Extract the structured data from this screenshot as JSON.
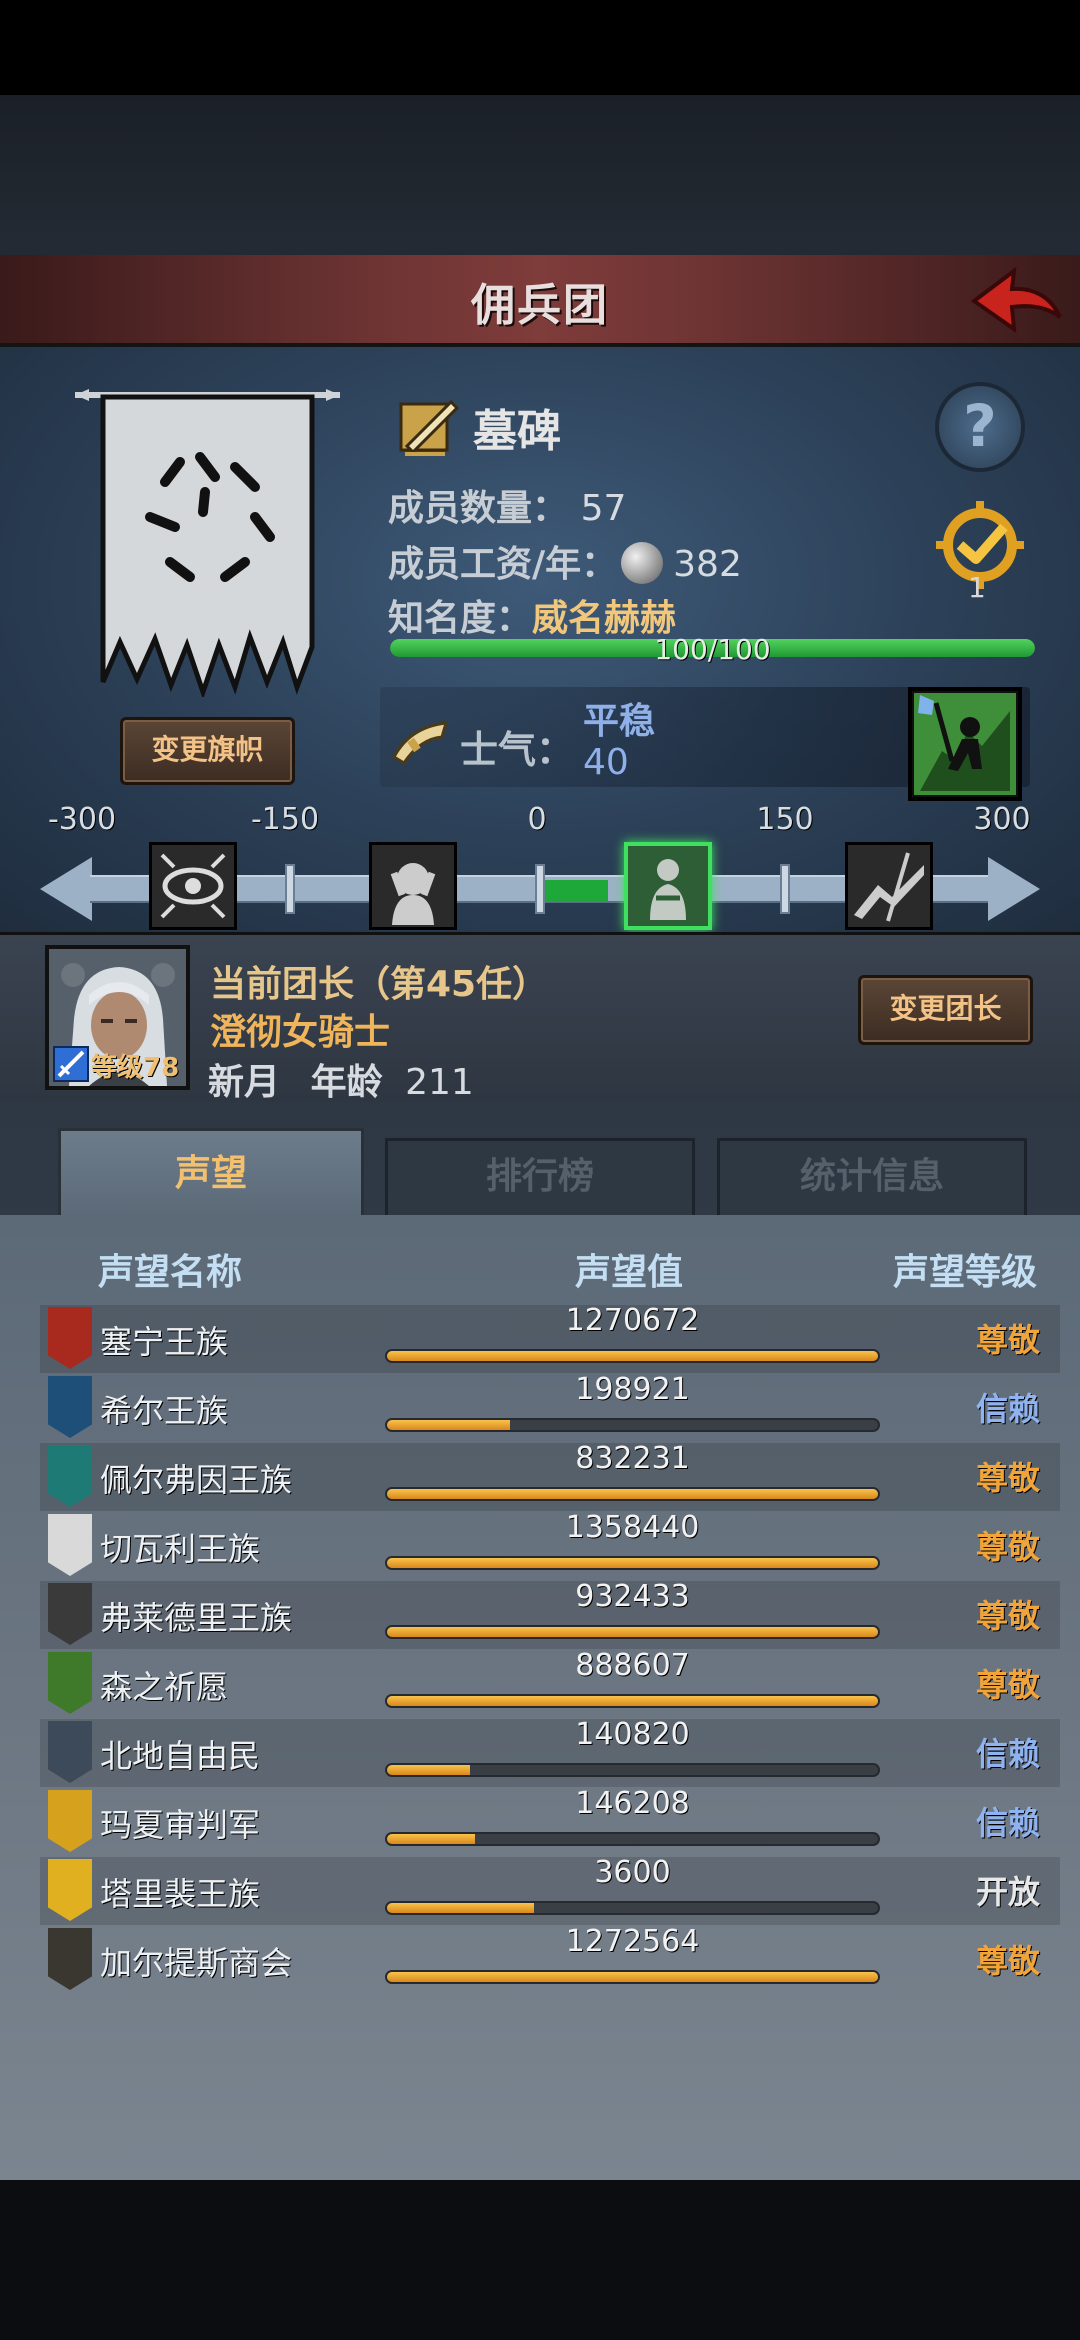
{
  "header": {
    "title": "佣兵团"
  },
  "guild": {
    "change_banner_label": "变更旗帜",
    "name": "墓碑",
    "members_label": "成员数量：",
    "members_value": "57",
    "wage_label": "成员工资/年：",
    "wage_value": "382",
    "fame_label": "知名度：",
    "fame_value": "威名赫赫",
    "fame_progress": "100/100",
    "fame_fraction": 1.0,
    "help_label": "?",
    "target_count": "1",
    "morale_label": "士气：",
    "morale_state": "平稳",
    "morale_value": "40"
  },
  "morale_scale": {
    "labels": [
      "-300",
      "-150",
      "0",
      "150",
      "300"
    ]
  },
  "leader": {
    "title": "当前团长（第45任）",
    "name": "澄彻女骑士",
    "level_text": "等级78",
    "moon_label": "新月",
    "age_label": "年龄",
    "age_value": "211",
    "change_leader_label": "变更团长"
  },
  "tabs": [
    {
      "label": "声望",
      "active": true
    },
    {
      "label": "排行榜",
      "active": false
    },
    {
      "label": "统计信息",
      "active": false
    }
  ],
  "reputation": {
    "headers": {
      "name": "声望名称",
      "value": "声望值",
      "level": "声望等级"
    },
    "rows": [
      {
        "name": "塞宁王族",
        "value": "1270672",
        "fill": 1.0,
        "level": "尊敬",
        "level_color": "#f0a43a",
        "icon_color": "#a82a1e"
      },
      {
        "name": "希尔王族",
        "value": "198921",
        "fill": 0.25,
        "level": "信赖",
        "level_color": "#8fb3f0",
        "icon_color": "#1e4f78"
      },
      {
        "name": "佩尔弗因王族",
        "value": "832231",
        "fill": 1.0,
        "level": "尊敬",
        "level_color": "#f0a43a",
        "icon_color": "#1d7a74"
      },
      {
        "name": "切瓦利王族",
        "value": "1358440",
        "fill": 1.0,
        "level": "尊敬",
        "level_color": "#f0a43a",
        "icon_color": "#d9d9d9"
      },
      {
        "name": "弗莱德里王族",
        "value": "932433",
        "fill": 1.0,
        "level": "尊敬",
        "level_color": "#f0a43a",
        "icon_color": "#3a3a3a"
      },
      {
        "name": "森之祈愿",
        "value": "888607",
        "fill": 1.0,
        "level": "尊敬",
        "level_color": "#f0a43a",
        "icon_color": "#3f7a2a"
      },
      {
        "name": "北地自由民",
        "value": "140820",
        "fill": 0.17,
        "level": "信赖",
        "level_color": "#8fb3f0",
        "icon_color": "#3c4a5a"
      },
      {
        "name": "玛夏审判军",
        "value": "146208",
        "fill": 0.18,
        "level": "信赖",
        "level_color": "#8fb3f0",
        "icon_color": "#d6a21e"
      },
      {
        "name": "塔里裴王族",
        "value": "3600",
        "fill": 0.3,
        "level": "开放",
        "level_color": "#e8e8e8",
        "icon_color": "#e0b020"
      },
      {
        "name": "加尔提斯商会",
        "value": "1272564",
        "fill": 1.0,
        "level": "尊敬",
        "level_color": "#f0a43a",
        "icon_color": "#3a3630"
      }
    ]
  }
}
